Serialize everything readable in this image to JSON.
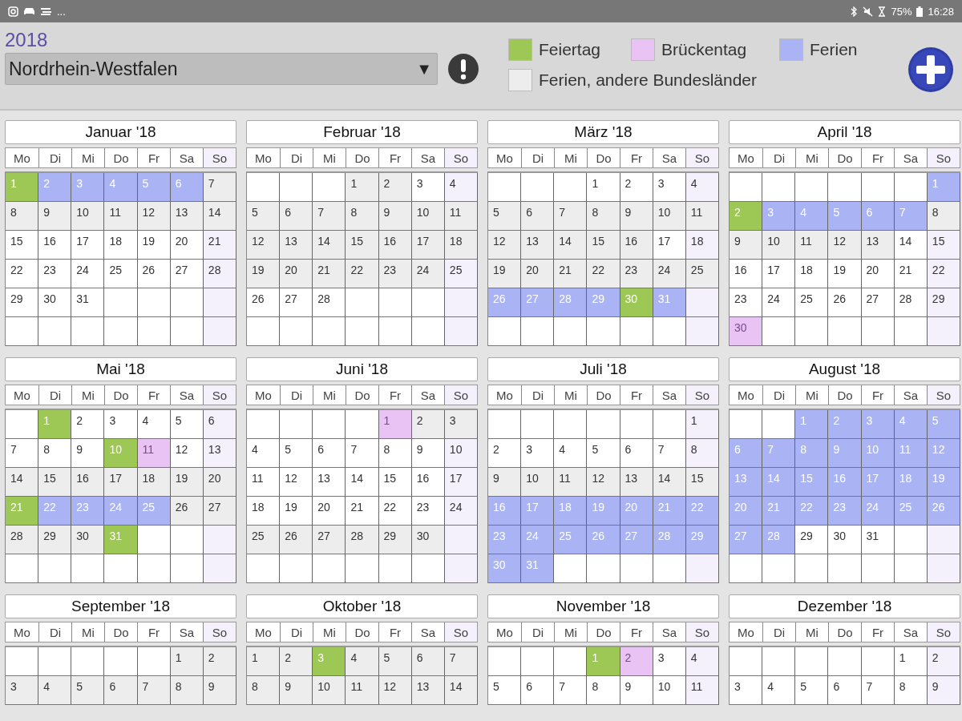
{
  "status_bar": {
    "more": "...",
    "battery": "75%",
    "time": "16:28"
  },
  "year": "2018",
  "state_select": {
    "value": "Nordrhein-Westfalen",
    "arrow": "▼"
  },
  "legend": [
    {
      "label": "Feiertag",
      "kind": "feiertag",
      "color": "#9dc855"
    },
    {
      "label": "Brückentag",
      "kind": "brueckentag",
      "color": "#e8c3f3"
    },
    {
      "label": "Ferien",
      "kind": "ferien",
      "color": "#aab4f5"
    },
    {
      "label": "Ferien, andere Bundesländer",
      "kind": "andere",
      "color": "#ededed"
    }
  ],
  "months": [
    {
      "title": "Januar '18",
      "weekdays": [
        "Mo",
        "Di",
        "Mi",
        "Do",
        "Fr",
        "Sa",
        "So"
      ],
      "weeks": [
        [
          {
            "day": "1",
            "kind": "feiertag"
          },
          {
            "day": "2",
            "kind": "ferien"
          },
          {
            "day": "3",
            "kind": "ferien"
          },
          {
            "day": "4",
            "kind": "ferien"
          },
          {
            "day": "5",
            "kind": "ferien"
          },
          {
            "day": "6",
            "kind": "ferien"
          },
          {
            "day": "7",
            "kind": "andere"
          }
        ],
        [
          {
            "day": "8",
            "kind": "andere"
          },
          {
            "day": "9",
            "kind": "andere"
          },
          {
            "day": "10",
            "kind": "andere"
          },
          {
            "day": "11",
            "kind": "andere"
          },
          {
            "day": "12",
            "kind": "andere"
          },
          {
            "day": "13",
            "kind": "andere"
          },
          {
            "day": "14",
            "kind": "andere"
          }
        ],
        [
          {
            "day": "15",
            "kind": "normal"
          },
          {
            "day": "16",
            "kind": "normal"
          },
          {
            "day": "17",
            "kind": "normal"
          },
          {
            "day": "18",
            "kind": "normal"
          },
          {
            "day": "19",
            "kind": "normal"
          },
          {
            "day": "20",
            "kind": "normal"
          },
          {
            "day": "21",
            "kind": "normal"
          }
        ],
        [
          {
            "day": "22",
            "kind": "normal"
          },
          {
            "day": "23",
            "kind": "normal"
          },
          {
            "day": "24",
            "kind": "normal"
          },
          {
            "day": "25",
            "kind": "normal"
          },
          {
            "day": "26",
            "kind": "normal"
          },
          {
            "day": "27",
            "kind": "normal"
          },
          {
            "day": "28",
            "kind": "normal"
          }
        ],
        [
          {
            "day": "29",
            "kind": "normal"
          },
          {
            "day": "30",
            "kind": "normal"
          },
          {
            "day": "31",
            "kind": "normal"
          },
          {
            "kind": "blank"
          },
          {
            "kind": "blank"
          },
          {
            "kind": "blank"
          },
          {
            "kind": "blank"
          }
        ],
        [
          {
            "kind": "blank"
          },
          {
            "kind": "blank"
          },
          {
            "kind": "blank"
          },
          {
            "kind": "blank"
          },
          {
            "kind": "blank"
          },
          {
            "kind": "blank"
          },
          {
            "kind": "blank"
          }
        ]
      ]
    },
    {
      "title": "Februar '18",
      "weekdays": [
        "Mo",
        "Di",
        "Mi",
        "Do",
        "Fr",
        "Sa",
        "So"
      ],
      "weeks": [
        [
          {
            "kind": "blank"
          },
          {
            "kind": "blank"
          },
          {
            "kind": "blank"
          },
          {
            "day": "1",
            "kind": "andere"
          },
          {
            "day": "2",
            "kind": "andere"
          },
          {
            "day": "3",
            "kind": "normal"
          },
          {
            "day": "4",
            "kind": "normal"
          }
        ],
        [
          {
            "day": "5",
            "kind": "andere"
          },
          {
            "day": "6",
            "kind": "andere"
          },
          {
            "day": "7",
            "kind": "andere"
          },
          {
            "day": "8",
            "kind": "andere"
          },
          {
            "day": "9",
            "kind": "andere"
          },
          {
            "day": "10",
            "kind": "andere"
          },
          {
            "day": "11",
            "kind": "andere"
          }
        ],
        [
          {
            "day": "12",
            "kind": "andere"
          },
          {
            "day": "13",
            "kind": "andere"
          },
          {
            "day": "14",
            "kind": "andere"
          },
          {
            "day": "15",
            "kind": "andere"
          },
          {
            "day": "16",
            "kind": "andere"
          },
          {
            "day": "17",
            "kind": "andere"
          },
          {
            "day": "18",
            "kind": "andere"
          }
        ],
        [
          {
            "day": "19",
            "kind": "andere"
          },
          {
            "day": "20",
            "kind": "andere"
          },
          {
            "day": "21",
            "kind": "andere"
          },
          {
            "day": "22",
            "kind": "andere"
          },
          {
            "day": "23",
            "kind": "andere"
          },
          {
            "day": "24",
            "kind": "andere"
          },
          {
            "day": "25",
            "kind": "normal"
          }
        ],
        [
          {
            "day": "26",
            "kind": "normal"
          },
          {
            "day": "27",
            "kind": "normal"
          },
          {
            "day": "28",
            "kind": "normal"
          },
          {
            "kind": "blank"
          },
          {
            "kind": "blank"
          },
          {
            "kind": "blank"
          },
          {
            "kind": "blank"
          }
        ],
        [
          {
            "kind": "blank"
          },
          {
            "kind": "blank"
          },
          {
            "kind": "blank"
          },
          {
            "kind": "blank"
          },
          {
            "kind": "blank"
          },
          {
            "kind": "blank"
          },
          {
            "kind": "blank"
          }
        ]
      ]
    },
    {
      "title": "März '18",
      "weekdays": [
        "Mo",
        "Di",
        "Mi",
        "Do",
        "Fr",
        "Sa",
        "So"
      ],
      "weeks": [
        [
          {
            "kind": "blank"
          },
          {
            "kind": "blank"
          },
          {
            "kind": "blank"
          },
          {
            "day": "1",
            "kind": "normal"
          },
          {
            "day": "2",
            "kind": "normal"
          },
          {
            "day": "3",
            "kind": "normal"
          },
          {
            "day": "4",
            "kind": "normal"
          }
        ],
        [
          {
            "day": "5",
            "kind": "andere"
          },
          {
            "day": "6",
            "kind": "andere"
          },
          {
            "day": "7",
            "kind": "andere"
          },
          {
            "day": "8",
            "kind": "andere"
          },
          {
            "day": "9",
            "kind": "andere"
          },
          {
            "day": "10",
            "kind": "andere"
          },
          {
            "day": "11",
            "kind": "andere"
          }
        ],
        [
          {
            "day": "12",
            "kind": "andere"
          },
          {
            "day": "13",
            "kind": "andere"
          },
          {
            "day": "14",
            "kind": "andere"
          },
          {
            "day": "15",
            "kind": "andere"
          },
          {
            "day": "16",
            "kind": "andere"
          },
          {
            "day": "17",
            "kind": "normal"
          },
          {
            "day": "18",
            "kind": "normal"
          }
        ],
        [
          {
            "day": "19",
            "kind": "andere"
          },
          {
            "day": "20",
            "kind": "andere"
          },
          {
            "day": "21",
            "kind": "andere"
          },
          {
            "day": "22",
            "kind": "andere"
          },
          {
            "day": "23",
            "kind": "andere"
          },
          {
            "day": "24",
            "kind": "andere"
          },
          {
            "day": "25",
            "kind": "andere"
          }
        ],
        [
          {
            "day": "26",
            "kind": "ferien"
          },
          {
            "day": "27",
            "kind": "ferien"
          },
          {
            "day": "28",
            "kind": "ferien"
          },
          {
            "day": "29",
            "kind": "ferien"
          },
          {
            "day": "30",
            "kind": "feiertag"
          },
          {
            "day": "31",
            "kind": "ferien"
          },
          {
            "kind": "blank"
          }
        ],
        [
          {
            "kind": "blank"
          },
          {
            "kind": "blank"
          },
          {
            "kind": "blank"
          },
          {
            "kind": "blank"
          },
          {
            "kind": "blank"
          },
          {
            "kind": "blank"
          },
          {
            "kind": "blank"
          }
        ]
      ]
    },
    {
      "title": "April '18",
      "weekdays": [
        "Mo",
        "Di",
        "Mi",
        "Do",
        "Fr",
        "Sa",
        "So"
      ],
      "weeks": [
        [
          {
            "kind": "blank"
          },
          {
            "kind": "blank"
          },
          {
            "kind": "blank"
          },
          {
            "kind": "blank"
          },
          {
            "kind": "blank"
          },
          {
            "kind": "blank"
          },
          {
            "day": "1",
            "kind": "ferien"
          }
        ],
        [
          {
            "day": "2",
            "kind": "feiertag"
          },
          {
            "day": "3",
            "kind": "ferien"
          },
          {
            "day": "4",
            "kind": "ferien"
          },
          {
            "day": "5",
            "kind": "ferien"
          },
          {
            "day": "6",
            "kind": "ferien"
          },
          {
            "day": "7",
            "kind": "ferien"
          },
          {
            "day": "8",
            "kind": "andere"
          }
        ],
        [
          {
            "day": "9",
            "kind": "andere"
          },
          {
            "day": "10",
            "kind": "andere"
          },
          {
            "day": "11",
            "kind": "andere"
          },
          {
            "day": "12",
            "kind": "andere"
          },
          {
            "day": "13",
            "kind": "andere"
          },
          {
            "day": "14",
            "kind": "normal"
          },
          {
            "day": "15",
            "kind": "normal"
          }
        ],
        [
          {
            "day": "16",
            "kind": "normal"
          },
          {
            "day": "17",
            "kind": "normal"
          },
          {
            "day": "18",
            "kind": "normal"
          },
          {
            "day": "19",
            "kind": "normal"
          },
          {
            "day": "20",
            "kind": "normal"
          },
          {
            "day": "21",
            "kind": "normal"
          },
          {
            "day": "22",
            "kind": "normal"
          }
        ],
        [
          {
            "day": "23",
            "kind": "normal"
          },
          {
            "day": "24",
            "kind": "normal"
          },
          {
            "day": "25",
            "kind": "normal"
          },
          {
            "day": "26",
            "kind": "normal"
          },
          {
            "day": "27",
            "kind": "normal"
          },
          {
            "day": "28",
            "kind": "normal"
          },
          {
            "day": "29",
            "kind": "normal"
          }
        ],
        [
          {
            "day": "30",
            "kind": "brueckentag"
          },
          {
            "kind": "blank"
          },
          {
            "kind": "blank"
          },
          {
            "kind": "blank"
          },
          {
            "kind": "blank"
          },
          {
            "kind": "blank"
          },
          {
            "kind": "blank"
          }
        ]
      ]
    },
    {
      "title": "Mai '18",
      "weekdays": [
        "Mo",
        "Di",
        "Mi",
        "Do",
        "Fr",
        "Sa",
        "So"
      ],
      "weeks": [
        [
          {
            "kind": "blank"
          },
          {
            "day": "1",
            "kind": "feiertag"
          },
          {
            "day": "2",
            "kind": "normal"
          },
          {
            "day": "3",
            "kind": "normal"
          },
          {
            "day": "4",
            "kind": "normal"
          },
          {
            "day": "5",
            "kind": "normal"
          },
          {
            "day": "6",
            "kind": "normal"
          }
        ],
        [
          {
            "day": "7",
            "kind": "normal"
          },
          {
            "day": "8",
            "kind": "normal"
          },
          {
            "day": "9",
            "kind": "normal"
          },
          {
            "day": "10",
            "kind": "feiertag"
          },
          {
            "day": "11",
            "kind": "brueckentag"
          },
          {
            "day": "12",
            "kind": "normal"
          },
          {
            "day": "13",
            "kind": "normal"
          }
        ],
        [
          {
            "day": "14",
            "kind": "andere"
          },
          {
            "day": "15",
            "kind": "andere"
          },
          {
            "day": "16",
            "kind": "andere"
          },
          {
            "day": "17",
            "kind": "andere"
          },
          {
            "day": "18",
            "kind": "andere"
          },
          {
            "day": "19",
            "kind": "andere"
          },
          {
            "day": "20",
            "kind": "andere"
          }
        ],
        [
          {
            "day": "21",
            "kind": "feiertag"
          },
          {
            "day": "22",
            "kind": "ferien"
          },
          {
            "day": "23",
            "kind": "ferien"
          },
          {
            "day": "24",
            "kind": "ferien"
          },
          {
            "day": "25",
            "kind": "ferien"
          },
          {
            "day": "26",
            "kind": "andere"
          },
          {
            "day": "27",
            "kind": "andere"
          }
        ],
        [
          {
            "day": "28",
            "kind": "andere"
          },
          {
            "day": "29",
            "kind": "andere"
          },
          {
            "day": "30",
            "kind": "andere"
          },
          {
            "day": "31",
            "kind": "feiertag"
          },
          {
            "kind": "blank"
          },
          {
            "kind": "blank"
          },
          {
            "kind": "blank"
          }
        ],
        [
          {
            "kind": "blank"
          },
          {
            "kind": "blank"
          },
          {
            "kind": "blank"
          },
          {
            "kind": "blank"
          },
          {
            "kind": "blank"
          },
          {
            "kind": "blank"
          },
          {
            "kind": "blank"
          }
        ]
      ]
    },
    {
      "title": "Juni '18",
      "weekdays": [
        "Mo",
        "Di",
        "Mi",
        "Do",
        "Fr",
        "Sa",
        "So"
      ],
      "weeks": [
        [
          {
            "kind": "blank"
          },
          {
            "kind": "blank"
          },
          {
            "kind": "blank"
          },
          {
            "kind": "blank"
          },
          {
            "day": "1",
            "kind": "brueckentag"
          },
          {
            "day": "2",
            "kind": "andere"
          },
          {
            "day": "3",
            "kind": "andere"
          }
        ],
        [
          {
            "day": "4",
            "kind": "normal"
          },
          {
            "day": "5",
            "kind": "normal"
          },
          {
            "day": "6",
            "kind": "normal"
          },
          {
            "day": "7",
            "kind": "normal"
          },
          {
            "day": "8",
            "kind": "normal"
          },
          {
            "day": "9",
            "kind": "normal"
          },
          {
            "day": "10",
            "kind": "normal"
          }
        ],
        [
          {
            "day": "11",
            "kind": "normal"
          },
          {
            "day": "12",
            "kind": "normal"
          },
          {
            "day": "13",
            "kind": "normal"
          },
          {
            "day": "14",
            "kind": "normal"
          },
          {
            "day": "15",
            "kind": "normal"
          },
          {
            "day": "16",
            "kind": "normal"
          },
          {
            "day": "17",
            "kind": "normal"
          }
        ],
        [
          {
            "day": "18",
            "kind": "normal"
          },
          {
            "day": "19",
            "kind": "normal"
          },
          {
            "day": "20",
            "kind": "normal"
          },
          {
            "day": "21",
            "kind": "normal"
          },
          {
            "day": "22",
            "kind": "normal"
          },
          {
            "day": "23",
            "kind": "normal"
          },
          {
            "day": "24",
            "kind": "normal"
          }
        ],
        [
          {
            "day": "25",
            "kind": "andere"
          },
          {
            "day": "26",
            "kind": "andere"
          },
          {
            "day": "27",
            "kind": "andere"
          },
          {
            "day": "28",
            "kind": "andere"
          },
          {
            "day": "29",
            "kind": "andere"
          },
          {
            "day": "30",
            "kind": "andere"
          },
          {
            "kind": "blank"
          }
        ],
        [
          {
            "kind": "blank"
          },
          {
            "kind": "blank"
          },
          {
            "kind": "blank"
          },
          {
            "kind": "blank"
          },
          {
            "kind": "blank"
          },
          {
            "kind": "blank"
          },
          {
            "kind": "blank"
          }
        ]
      ]
    },
    {
      "title": "Juli '18",
      "weekdays": [
        "Mo",
        "Di",
        "Mi",
        "Do",
        "Fr",
        "Sa",
        "So"
      ],
      "weeks": [
        [
          {
            "kind": "blank"
          },
          {
            "kind": "blank"
          },
          {
            "kind": "blank"
          },
          {
            "kind": "blank"
          },
          {
            "kind": "blank"
          },
          {
            "kind": "blank"
          },
          {
            "day": "1",
            "kind": "normal"
          }
        ],
        [
          {
            "day": "2",
            "kind": "normal"
          },
          {
            "day": "3",
            "kind": "normal"
          },
          {
            "day": "4",
            "kind": "normal"
          },
          {
            "day": "5",
            "kind": "normal"
          },
          {
            "day": "6",
            "kind": "normal"
          },
          {
            "day": "7",
            "kind": "normal"
          },
          {
            "day": "8",
            "kind": "normal"
          }
        ],
        [
          {
            "day": "9",
            "kind": "andere"
          },
          {
            "day": "10",
            "kind": "andere"
          },
          {
            "day": "11",
            "kind": "andere"
          },
          {
            "day": "12",
            "kind": "andere"
          },
          {
            "day": "13",
            "kind": "andere"
          },
          {
            "day": "14",
            "kind": "andere"
          },
          {
            "day": "15",
            "kind": "andere"
          }
        ],
        [
          {
            "day": "16",
            "kind": "ferien"
          },
          {
            "day": "17",
            "kind": "ferien"
          },
          {
            "day": "18",
            "kind": "ferien"
          },
          {
            "day": "19",
            "kind": "ferien"
          },
          {
            "day": "20",
            "kind": "ferien"
          },
          {
            "day": "21",
            "kind": "ferien"
          },
          {
            "day": "22",
            "kind": "ferien"
          }
        ],
        [
          {
            "day": "23",
            "kind": "ferien"
          },
          {
            "day": "24",
            "kind": "ferien"
          },
          {
            "day": "25",
            "kind": "ferien"
          },
          {
            "day": "26",
            "kind": "ferien"
          },
          {
            "day": "27",
            "kind": "ferien"
          },
          {
            "day": "28",
            "kind": "ferien"
          },
          {
            "day": "29",
            "kind": "ferien"
          }
        ],
        [
          {
            "day": "30",
            "kind": "ferien"
          },
          {
            "day": "31",
            "kind": "ferien"
          },
          {
            "kind": "blank"
          },
          {
            "kind": "blank"
          },
          {
            "kind": "blank"
          },
          {
            "kind": "blank"
          },
          {
            "kind": "blank"
          }
        ]
      ]
    },
    {
      "title": "August '18",
      "weekdays": [
        "Mo",
        "Di",
        "Mi",
        "Do",
        "Fr",
        "Sa",
        "So"
      ],
      "weeks": [
        [
          {
            "kind": "blank"
          },
          {
            "kind": "blank"
          },
          {
            "day": "1",
            "kind": "ferien"
          },
          {
            "day": "2",
            "kind": "ferien"
          },
          {
            "day": "3",
            "kind": "ferien"
          },
          {
            "day": "4",
            "kind": "ferien"
          },
          {
            "day": "5",
            "kind": "ferien"
          }
        ],
        [
          {
            "day": "6",
            "kind": "ferien"
          },
          {
            "day": "7",
            "kind": "ferien"
          },
          {
            "day": "8",
            "kind": "ferien"
          },
          {
            "day": "9",
            "kind": "ferien"
          },
          {
            "day": "10",
            "kind": "ferien"
          },
          {
            "day": "11",
            "kind": "ferien"
          },
          {
            "day": "12",
            "kind": "ferien"
          }
        ],
        [
          {
            "day": "13",
            "kind": "ferien"
          },
          {
            "day": "14",
            "kind": "ferien"
          },
          {
            "day": "15",
            "kind": "ferien"
          },
          {
            "day": "16",
            "kind": "ferien"
          },
          {
            "day": "17",
            "kind": "ferien"
          },
          {
            "day": "18",
            "kind": "ferien"
          },
          {
            "day": "19",
            "kind": "ferien"
          }
        ],
        [
          {
            "day": "20",
            "kind": "ferien"
          },
          {
            "day": "21",
            "kind": "ferien"
          },
          {
            "day": "22",
            "kind": "ferien"
          },
          {
            "day": "23",
            "kind": "ferien"
          },
          {
            "day": "24",
            "kind": "ferien"
          },
          {
            "day": "25",
            "kind": "ferien"
          },
          {
            "day": "26",
            "kind": "ferien"
          }
        ],
        [
          {
            "day": "27",
            "kind": "ferien"
          },
          {
            "day": "28",
            "kind": "ferien"
          },
          {
            "day": "29",
            "kind": "normal"
          },
          {
            "day": "30",
            "kind": "normal"
          },
          {
            "day": "31",
            "kind": "normal"
          },
          {
            "kind": "blank"
          },
          {
            "kind": "blank"
          }
        ],
        [
          {
            "kind": "blank"
          },
          {
            "kind": "blank"
          },
          {
            "kind": "blank"
          },
          {
            "kind": "blank"
          },
          {
            "kind": "blank"
          },
          {
            "kind": "blank"
          },
          {
            "kind": "blank"
          }
        ]
      ]
    },
    {
      "title": "September '18",
      "weekdays": [
        "Mo",
        "Di",
        "Mi",
        "Do",
        "Fr",
        "Sa",
        "So"
      ],
      "weeks": [
        [
          {
            "kind": "blank"
          },
          {
            "kind": "blank"
          },
          {
            "kind": "blank"
          },
          {
            "kind": "blank"
          },
          {
            "kind": "blank"
          },
          {
            "day": "1",
            "kind": "andere"
          },
          {
            "day": "2",
            "kind": "andere"
          }
        ],
        [
          {
            "day": "3",
            "kind": "andere"
          },
          {
            "day": "4",
            "kind": "andere"
          },
          {
            "day": "5",
            "kind": "andere"
          },
          {
            "day": "6",
            "kind": "andere"
          },
          {
            "day": "7",
            "kind": "andere"
          },
          {
            "day": "8",
            "kind": "andere"
          },
          {
            "day": "9",
            "kind": "andere"
          }
        ]
      ]
    },
    {
      "title": "Oktober '18",
      "weekdays": [
        "Mo",
        "Di",
        "Mi",
        "Do",
        "Fr",
        "Sa",
        "So"
      ],
      "weeks": [
        [
          {
            "day": "1",
            "kind": "andere"
          },
          {
            "day": "2",
            "kind": "andere"
          },
          {
            "day": "3",
            "kind": "feiertag"
          },
          {
            "day": "4",
            "kind": "andere"
          },
          {
            "day": "5",
            "kind": "andere"
          },
          {
            "day": "6",
            "kind": "andere"
          },
          {
            "day": "7",
            "kind": "andere"
          }
        ],
        [
          {
            "day": "8",
            "kind": "andere"
          },
          {
            "day": "9",
            "kind": "andere"
          },
          {
            "day": "10",
            "kind": "andere"
          },
          {
            "day": "11",
            "kind": "andere"
          },
          {
            "day": "12",
            "kind": "andere"
          },
          {
            "day": "13",
            "kind": "andere"
          },
          {
            "day": "14",
            "kind": "andere"
          }
        ]
      ]
    },
    {
      "title": "November '18",
      "weekdays": [
        "Mo",
        "Di",
        "Mi",
        "Do",
        "Fr",
        "Sa",
        "So"
      ],
      "weeks": [
        [
          {
            "kind": "blank"
          },
          {
            "kind": "blank"
          },
          {
            "kind": "blank"
          },
          {
            "day": "1",
            "kind": "feiertag"
          },
          {
            "day": "2",
            "kind": "brueckentag"
          },
          {
            "day": "3",
            "kind": "normal"
          },
          {
            "day": "4",
            "kind": "normal"
          }
        ],
        [
          {
            "day": "5",
            "kind": "normal"
          },
          {
            "day": "6",
            "kind": "normal"
          },
          {
            "day": "7",
            "kind": "normal"
          },
          {
            "day": "8",
            "kind": "normal"
          },
          {
            "day": "9",
            "kind": "normal"
          },
          {
            "day": "10",
            "kind": "normal"
          },
          {
            "day": "11",
            "kind": "normal"
          }
        ]
      ]
    },
    {
      "title": "Dezember '18",
      "weekdays": [
        "Mo",
        "Di",
        "Mi",
        "Do",
        "Fr",
        "Sa",
        "So"
      ],
      "weeks": [
        [
          {
            "kind": "blank"
          },
          {
            "kind": "blank"
          },
          {
            "kind": "blank"
          },
          {
            "kind": "blank"
          },
          {
            "kind": "blank"
          },
          {
            "day": "1",
            "kind": "normal"
          },
          {
            "day": "2",
            "kind": "normal"
          }
        ],
        [
          {
            "day": "3",
            "kind": "normal"
          },
          {
            "day": "4",
            "kind": "normal"
          },
          {
            "day": "5",
            "kind": "normal"
          },
          {
            "day": "6",
            "kind": "normal"
          },
          {
            "day": "7",
            "kind": "normal"
          },
          {
            "day": "8",
            "kind": "normal"
          },
          {
            "day": "9",
            "kind": "normal"
          }
        ]
      ]
    }
  ]
}
